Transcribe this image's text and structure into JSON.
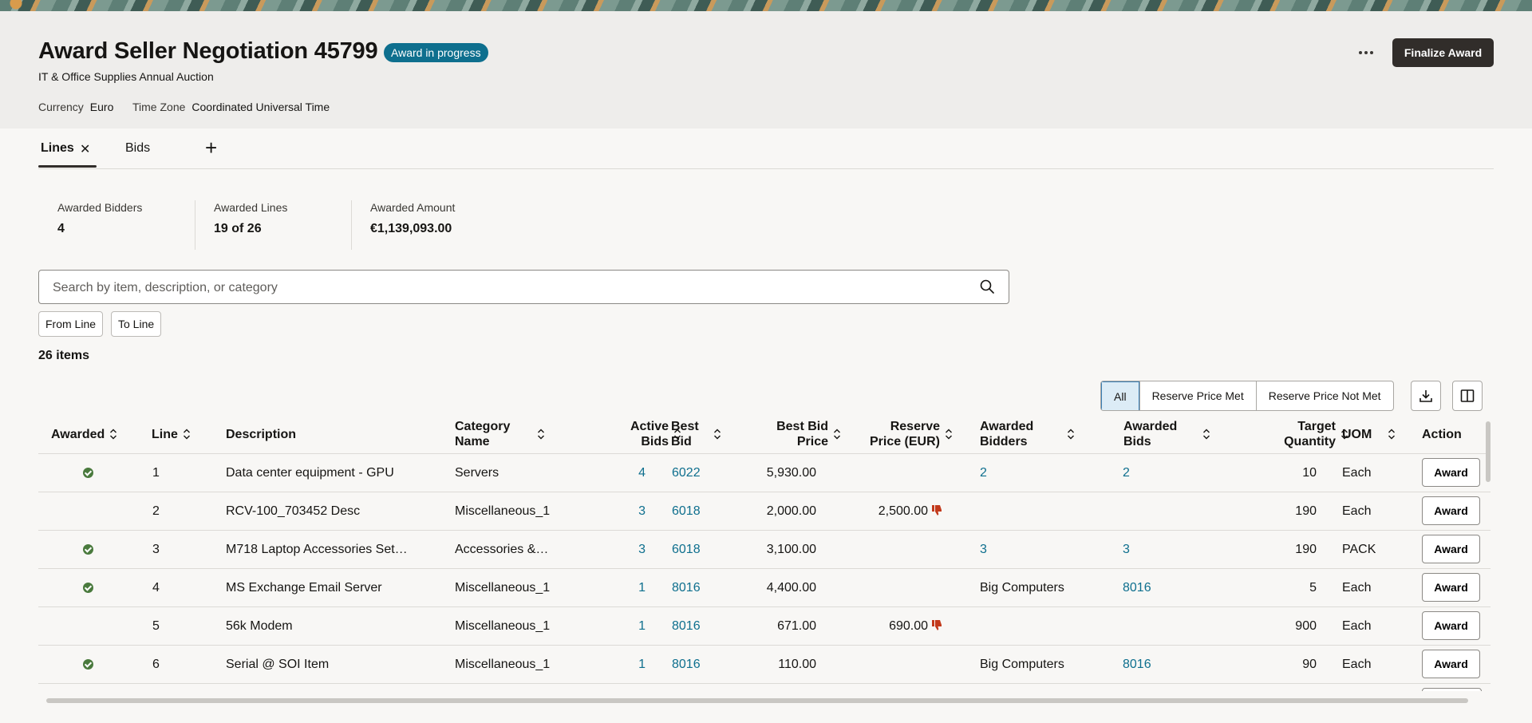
{
  "page": {
    "title": "Award Seller Negotiation 45799",
    "status_badge": "Award in progress",
    "subtitle": "IT & Office Supplies Annual Auction",
    "currency_label": "Currency",
    "currency_value": "Euro",
    "timezone_label": "Time Zone",
    "timezone_value": "Coordinated Universal Time",
    "finalize_label": "Finalize Award"
  },
  "tabs": [
    {
      "label": "Lines",
      "active": true,
      "closable": true
    },
    {
      "label": "Bids",
      "active": false,
      "closable": false
    }
  ],
  "kpis": [
    {
      "label": "Awarded Bidders",
      "value": "4"
    },
    {
      "label": "Awarded Lines",
      "value": "19 of 26"
    },
    {
      "label": "Awarded Amount",
      "value": "€1,139,093.00"
    }
  ],
  "search": {
    "placeholder": "Search by item, description, or category",
    "value": ""
  },
  "filters": {
    "from_line": "From Line",
    "to_line": "To Line"
  },
  "item_count": "26 items",
  "segmented": [
    "All",
    "Reserve Price Met",
    "Reserve Price Not Met"
  ],
  "columns": {
    "awarded": "Awarded",
    "line": "Line",
    "description": "Description",
    "category_l1": "Category",
    "category_l2": "Name",
    "active_l1": "Active",
    "active_l2": "Bids",
    "best_l1": "Best",
    "best_l2": "Bid",
    "price_l1": "Best Bid",
    "price_l2": "Price",
    "reserve_l1": "Reserve",
    "reserve_l2": "Price (EUR)",
    "bidders_l1": "Awarded",
    "bidders_l2": "Bidders",
    "bids_l1": "Awarded",
    "bids_l2": "Bids",
    "target_l1": "Target",
    "target_l2": "Quantity",
    "uom": "UOM",
    "action": "Action"
  },
  "rows": [
    {
      "awarded": true,
      "line": "1",
      "description": "Data center equipment - GPU",
      "category": "Servers",
      "active_bids": "4",
      "best_bid": "6022",
      "best_bid_price": "5,930.00",
      "reserve_price": "",
      "reserve_not_met": false,
      "awarded_bidders": "2",
      "awarded_bidders_link": true,
      "awarded_bids": "2",
      "target_qty": "10",
      "uom": "Each",
      "action": "Award"
    },
    {
      "awarded": false,
      "line": "2",
      "description": "RCV-100_703452 Desc",
      "category": "Miscellaneous_1",
      "active_bids": "3",
      "best_bid": "6018",
      "best_bid_price": "2,000.00",
      "reserve_price": "2,500.00",
      "reserve_not_met": true,
      "awarded_bidders": "",
      "awarded_bidders_link": false,
      "awarded_bids": "",
      "target_qty": "190",
      "uom": "Each",
      "action": "Award"
    },
    {
      "awarded": true,
      "line": "3",
      "description": "M718 Laptop Accessories Set…",
      "category": "Accessories &…",
      "active_bids": "3",
      "best_bid": "6018",
      "best_bid_price": "3,100.00",
      "reserve_price": "",
      "reserve_not_met": false,
      "awarded_bidders": "3",
      "awarded_bidders_link": true,
      "awarded_bids": "3",
      "target_qty": "190",
      "uom": "PACK",
      "action": "Award"
    },
    {
      "awarded": true,
      "line": "4",
      "description": "MS Exchange Email Server",
      "category": "Miscellaneous_1",
      "active_bids": "1",
      "best_bid": "8016",
      "best_bid_price": "4,400.00",
      "reserve_price": "",
      "reserve_not_met": false,
      "awarded_bidders": "Big Computers",
      "awarded_bidders_link": false,
      "awarded_bids": "8016",
      "target_qty": "5",
      "uom": "Each",
      "action": "Award"
    },
    {
      "awarded": false,
      "line": "5",
      "description": "56k Modem",
      "category": "Miscellaneous_1",
      "active_bids": "1",
      "best_bid": "8016",
      "best_bid_price": "671.00",
      "reserve_price": "690.00",
      "reserve_not_met": true,
      "awarded_bidders": "",
      "awarded_bidders_link": false,
      "awarded_bids": "",
      "target_qty": "900",
      "uom": "Each",
      "action": "Award"
    },
    {
      "awarded": true,
      "line": "6",
      "description": "Serial @ SOI Item",
      "category": "Miscellaneous_1",
      "active_bids": "1",
      "best_bid": "8016",
      "best_bid_price": "110.00",
      "reserve_price": "",
      "reserve_not_met": false,
      "awarded_bidders": "Big Computers",
      "awarded_bidders_link": false,
      "awarded_bids": "8016",
      "target_qty": "90",
      "uom": "Each",
      "action": "Award"
    }
  ],
  "colors": {
    "link": "#0e6f8e",
    "badge": "#0e6f8e",
    "check": "#4a7a3d",
    "thumb_down": "#c2391b",
    "primary_button": "#312d2a"
  }
}
